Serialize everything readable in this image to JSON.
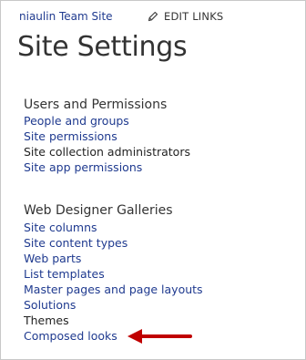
{
  "header": {
    "site_name": "niaulin Team Site",
    "edit_links_label": "EDIT LINKS",
    "edit_icon": "pencil-icon"
  },
  "page": {
    "title": "Site Settings"
  },
  "sections": {
    "users_permissions": {
      "heading": "Users and Permissions",
      "items": [
        "People and groups",
        "Site permissions",
        "Site collection administrators",
        "Site app permissions"
      ]
    },
    "web_designer_galleries": {
      "heading": "Web Designer Galleries",
      "items": [
        "Site columns",
        "Site content types",
        "Web parts",
        "List templates",
        "Master pages and page layouts",
        "Solutions",
        "Themes",
        "Composed looks"
      ]
    }
  },
  "annotation": {
    "icon": "red-arrow-icon",
    "color": "#c00000"
  },
  "colors": {
    "link": "#1f3a8f",
    "text": "#333333"
  }
}
